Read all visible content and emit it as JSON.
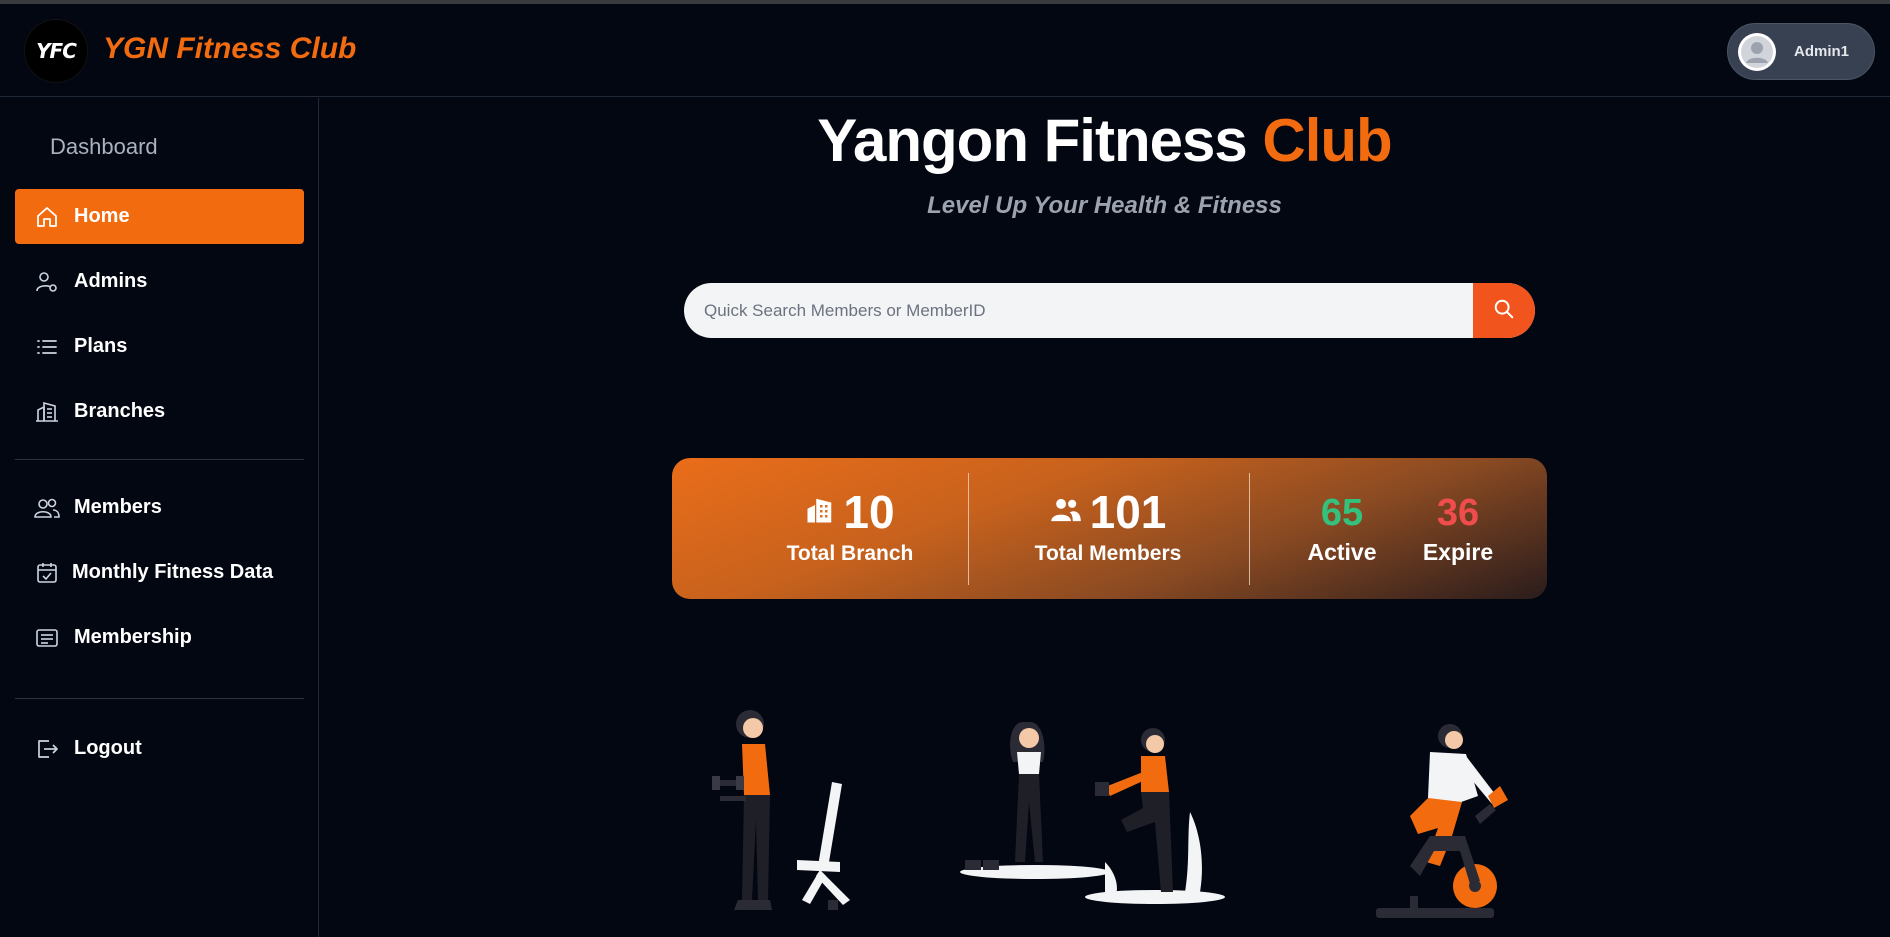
{
  "header": {
    "logo_text": "YFC",
    "brand": "YGN Fitness Club",
    "admin_name": "Admin1"
  },
  "sidebar": {
    "title": "Dashboard",
    "items": [
      {
        "label": "Home",
        "icon": "home-icon",
        "active": true
      },
      {
        "label": "Admins",
        "icon": "admin-settings-icon"
      },
      {
        "label": "Plans",
        "icon": "list-icon"
      },
      {
        "label": "Branches",
        "icon": "building-icon"
      },
      {
        "label": "Members",
        "icon": "users-icon"
      },
      {
        "label": "Monthly Fitness Data",
        "icon": "calendar-check-icon"
      },
      {
        "label": "Membership",
        "icon": "card-icon"
      },
      {
        "label": "Logout",
        "icon": "logout-icon"
      }
    ]
  },
  "main": {
    "title_part1": "Yangon Fitness ",
    "title_part2": "Club",
    "subtitle": "Level Up Your Health & Fitness",
    "search_placeholder": "Quick Search Members or MemberID"
  },
  "stats": {
    "total_branch_value": "10",
    "total_branch_label": "Total Branch",
    "total_members_value": "101",
    "total_members_label": "Total Members",
    "active_value": "65",
    "active_label": "Active",
    "expire_value": "36",
    "expire_label": "Expire"
  },
  "colors": {
    "accent": "#f26b0f",
    "background": "#030712",
    "active": "#34c17e",
    "expire": "#ef4d4d"
  }
}
